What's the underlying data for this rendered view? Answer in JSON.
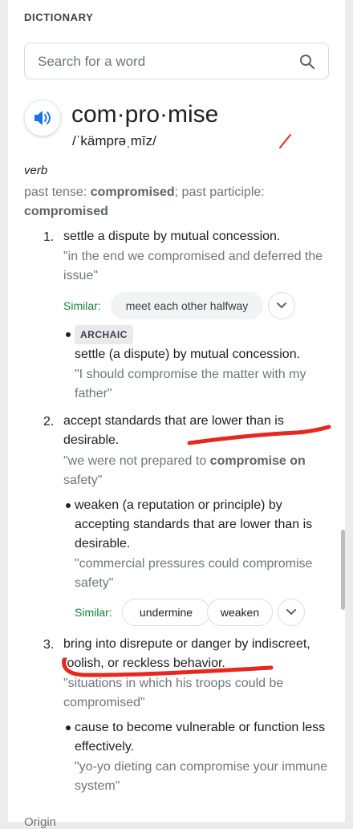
{
  "header": {
    "title": "DICTIONARY"
  },
  "search": {
    "placeholder": "Search for a word",
    "value": ""
  },
  "entry": {
    "word": "com·pro·mise",
    "phonetic": "/ˈkämprəˌmīz/",
    "part_of_speech": "verb",
    "tense": {
      "past_label": "past tense:",
      "past": "compromised",
      "participle_label": "past participle:",
      "participle": "compromised"
    },
    "senses": [
      {
        "number": "1.",
        "definition": "settle a dispute by mutual concession.",
        "example": "\"in the end we compromised and deferred the issue\"",
        "similar_label": "Similar:",
        "similar": [
          "meet each other halfway"
        ],
        "subsense": {
          "tag": "ARCHAIC",
          "definition": "settle (a dispute) by mutual concession.",
          "example": "\"I should compromise the matter with my father\""
        }
      },
      {
        "number": "2.",
        "definition": "accept standards that are lower than is desirable.",
        "example_before": "\"we were not prepared to ",
        "example_bold": "compromise on",
        "example_after": " safety\"",
        "subsense": {
          "definition": "weaken (a reputation or principle) by accepting standards that are lower than is desirable.",
          "example": "\"commercial pressures could compromise safety\"",
          "similar_label": "Similar:",
          "similar": [
            "undermine",
            "weaken"
          ]
        }
      },
      {
        "number": "3.",
        "definition": "bring into disrepute or danger by indiscreet, foolish, or reckless behavior.",
        "example": "\"situations in which his troops could be compromised\"",
        "subsense": {
          "definition": "cause to become vulnerable or function less effectively.",
          "example": "\"yo-yo dieting can compromise your immune system\""
        }
      }
    ],
    "origin_label": "Origin"
  },
  "colors": {
    "similar_label": "#188038",
    "speaker_icon": "#1a73e8",
    "annotation": "#e8271f"
  },
  "icons": [
    "search-icon",
    "speaker-icon",
    "chevron-down-icon"
  ]
}
